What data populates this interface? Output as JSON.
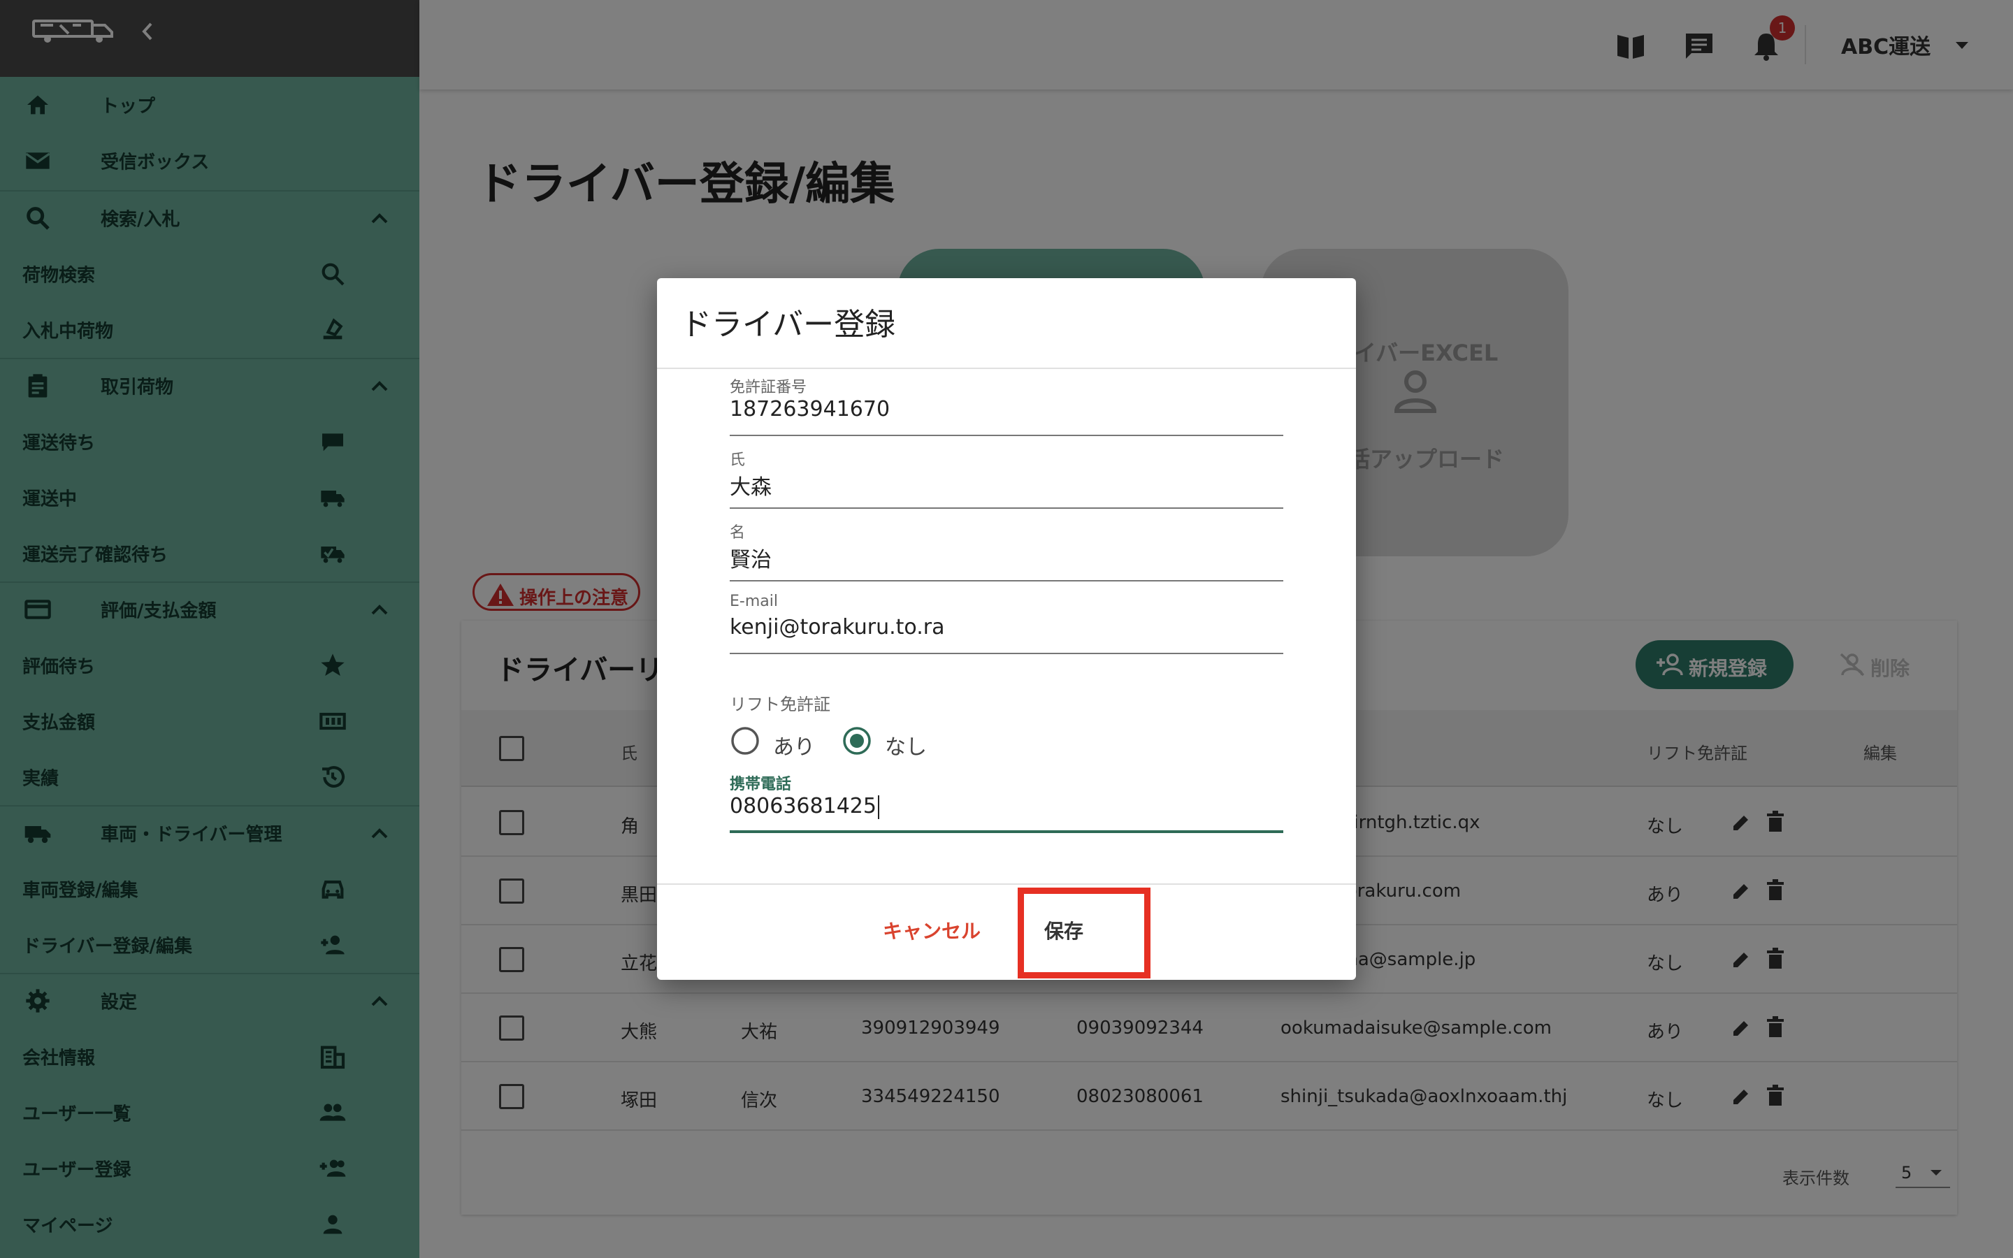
{
  "sidebar": {
    "items": [
      {
        "label": "トップ",
        "icon": "home-icon"
      },
      {
        "label": "受信ボックス",
        "icon": "mail-icon"
      },
      {
        "label": "検索/入札",
        "icon": "search-icon"
      },
      {
        "label": "荷物検索",
        "icon": "search-icon"
      },
      {
        "label": "入札中荷物",
        "icon": "gavel-icon"
      },
      {
        "label": "取引荷物",
        "icon": "clipboard-icon"
      },
      {
        "label": "運送待ち",
        "icon": "chat-bubble-icon"
      },
      {
        "label": "運送中",
        "icon": "truck-fast-icon"
      },
      {
        "label": "運送完了確認待ち",
        "icon": "truck-check-icon"
      },
      {
        "label": "評価/支払金額",
        "icon": "credit-card-icon"
      },
      {
        "label": "評価待ち",
        "icon": "star-icon"
      },
      {
        "label": "支払金額",
        "icon": "money-icon"
      },
      {
        "label": "実績",
        "icon": "history-icon"
      },
      {
        "label": "車両・ドライバー管理",
        "icon": "truck-icon"
      },
      {
        "label": "車両登録/編集",
        "icon": "car-icon"
      },
      {
        "label": "ドライバー登録/編集",
        "icon": "person-add-icon"
      },
      {
        "label": "設定",
        "icon": "gear-icon"
      },
      {
        "label": "会社情報",
        "icon": "building-icon"
      },
      {
        "label": "ユーザー一覧",
        "icon": "people-icon"
      },
      {
        "label": "ユーザー登録",
        "icon": "group-add-icon"
      },
      {
        "label": "マイページ",
        "icon": "person-icon"
      }
    ]
  },
  "header": {
    "notification_count": "1",
    "company": "ABC運送"
  },
  "page": {
    "title": "ドライバー登録/編集",
    "card_excel_line1": "ライバーEXCEL",
    "card_excel_line2": "一括アップロード",
    "caution": "操作上の注意"
  },
  "list": {
    "title": "ドライバーリ",
    "new_button": "新規登録",
    "delete_button": "削除",
    "columns": {
      "last": "氏",
      "lift": "リフト免許証",
      "edit": "編集"
    },
    "rows": [
      {
        "last": "角",
        "first": "",
        "license": "",
        "phone": "",
        "email": "045@siirntgh.tztic.qx",
        "lift": "なし"
      },
      {
        "last": "黒田",
        "first": "",
        "license": "",
        "phone": "",
        "email": "984@torakuru.com",
        "lift": "あり"
      },
      {
        "last": "立花",
        "first": "",
        "license": "",
        "phone": "",
        "email": "achibana@sample.jp",
        "lift": "なし"
      },
      {
        "last": "大熊",
        "first": "大祐",
        "license": "390912903949",
        "phone": "09039092344",
        "email": "ookumadaisuke@sample.com",
        "lift": "あり"
      },
      {
        "last": "塚田",
        "first": "信次",
        "license": "334549224150",
        "phone": "08023080061",
        "email": "shinji_tsukada@aoxlnxoaam.thj",
        "lift": "なし"
      }
    ],
    "pager_label": "表示件数",
    "pager_value": "5"
  },
  "modal": {
    "title": "ドライバー登録",
    "fields": {
      "license": {
        "label": "免許証番号",
        "value": "187263941670"
      },
      "last_name": {
        "label": "氏",
        "value": "大森"
      },
      "first_name": {
        "label": "名",
        "value": "賢治"
      },
      "email": {
        "label": "E-mail",
        "value": "kenji@torakuru.to.ra"
      },
      "phone": {
        "label": "携帯電話",
        "value": "08063681425"
      }
    },
    "lift": {
      "label": "リフト免許証",
      "yes": "あり",
      "no": "なし",
      "selected": "なし"
    },
    "cancel": "キャンセル",
    "save": "保存"
  },
  "colors": {
    "sidebar": "#6fb39f",
    "sidebar_top": "#4a4a4a",
    "accent": "#2e7d6b",
    "danger": "#d32f2f",
    "highlight": "#e63023"
  }
}
